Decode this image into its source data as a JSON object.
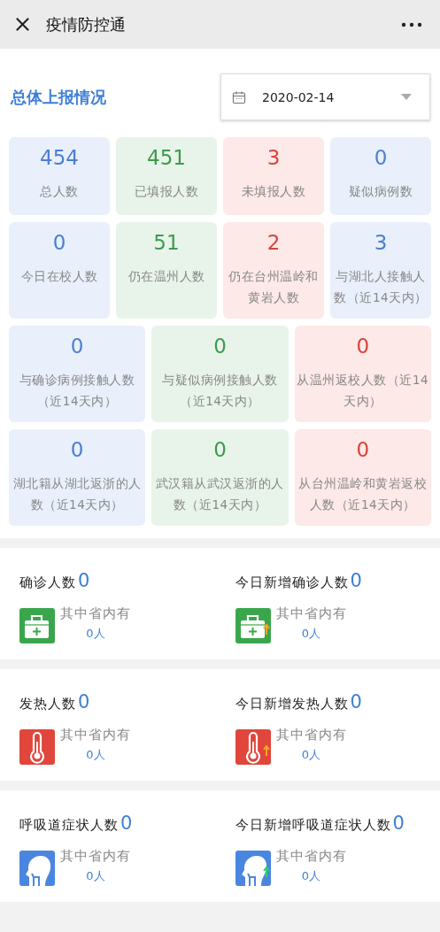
{
  "window": {
    "title": "疫情防控通"
  },
  "report": {
    "heading": "总体上报情况",
    "date": "2020-02-14"
  },
  "tile_rows": [
    [
      {
        "value": "454",
        "label": "总人数",
        "color": "#4a7fd0"
      },
      {
        "value": "451",
        "label": "已填报人数",
        "color": "#3e9a4e"
      },
      {
        "value": "3",
        "label": "未填报人数",
        "color": "#d8443c"
      },
      {
        "value": "0",
        "label": "疑似病例数",
        "color": "#4a7fd0"
      }
    ],
    [
      {
        "value": "0",
        "label": "今日在校人数",
        "color": "#4a7fd0"
      },
      {
        "value": "51",
        "label": "仍在温州人数",
        "color": "#3e9a4e"
      },
      {
        "value": "2",
        "label": "仍在台州温岭和黄岩人数",
        "color": "#d8443c"
      },
      {
        "value": "3",
        "label": "与湖北人接触人数（近14天内）",
        "color": "#4a7fd0"
      }
    ],
    [
      {
        "value": "0",
        "label": "与确诊病例接触人数（近14天内）",
        "color": "#4a7fd0"
      },
      {
        "value": "0",
        "label": "与疑似病例接触人数（近14天内）",
        "color": "#3e9a4e"
      },
      {
        "value": "0",
        "label": "从温州返校人数（近14天内）",
        "color": "#d8443c"
      }
    ],
    [
      {
        "value": "0",
        "label": "湖北籍从湖北返浙的人数（近14天内）",
        "color": "#4a7fd0"
      },
      {
        "value": "0",
        "label": "武汉籍从武汉返浙的人数（近14天内）",
        "color": "#3e9a4e"
      },
      {
        "value": "0",
        "label": "从台州温岭和黄岩返校人数（近14天内）",
        "color": "#d8443c"
      }
    ]
  ],
  "sections": [
    {
      "cells": [
        {
          "label": "确诊人数",
          "value": "0",
          "kind": "kit",
          "rising": false,
          "sub_label": "其中省内有",
          "sub_value": "0人"
        },
        {
          "label": "今日新增确诊人数",
          "value": "0",
          "kind": "kit",
          "rising": true,
          "sub_label": "其中省内有",
          "sub_value": "0人"
        }
      ]
    },
    {
      "cells": [
        {
          "label": "发热人数",
          "value": "0",
          "kind": "thermometer",
          "rising": false,
          "sub_label": "其中省内有",
          "sub_value": "0人"
        },
        {
          "label": "今日新增发热人数",
          "value": "0",
          "kind": "thermometer",
          "rising": true,
          "sub_label": "其中省内有",
          "sub_value": "0人"
        }
      ]
    },
    {
      "cells": [
        {
          "label": "呼吸道症状人数",
          "value": "0",
          "kind": "throat",
          "rising": false,
          "sub_label": "其中省内有",
          "sub_value": "0人"
        },
        {
          "label": "今日新增呼吸道症状人数",
          "value": "0",
          "kind": "throat",
          "rising": true,
          "sub_label": "其中省内有",
          "sub_value": "0人"
        }
      ]
    }
  ]
}
